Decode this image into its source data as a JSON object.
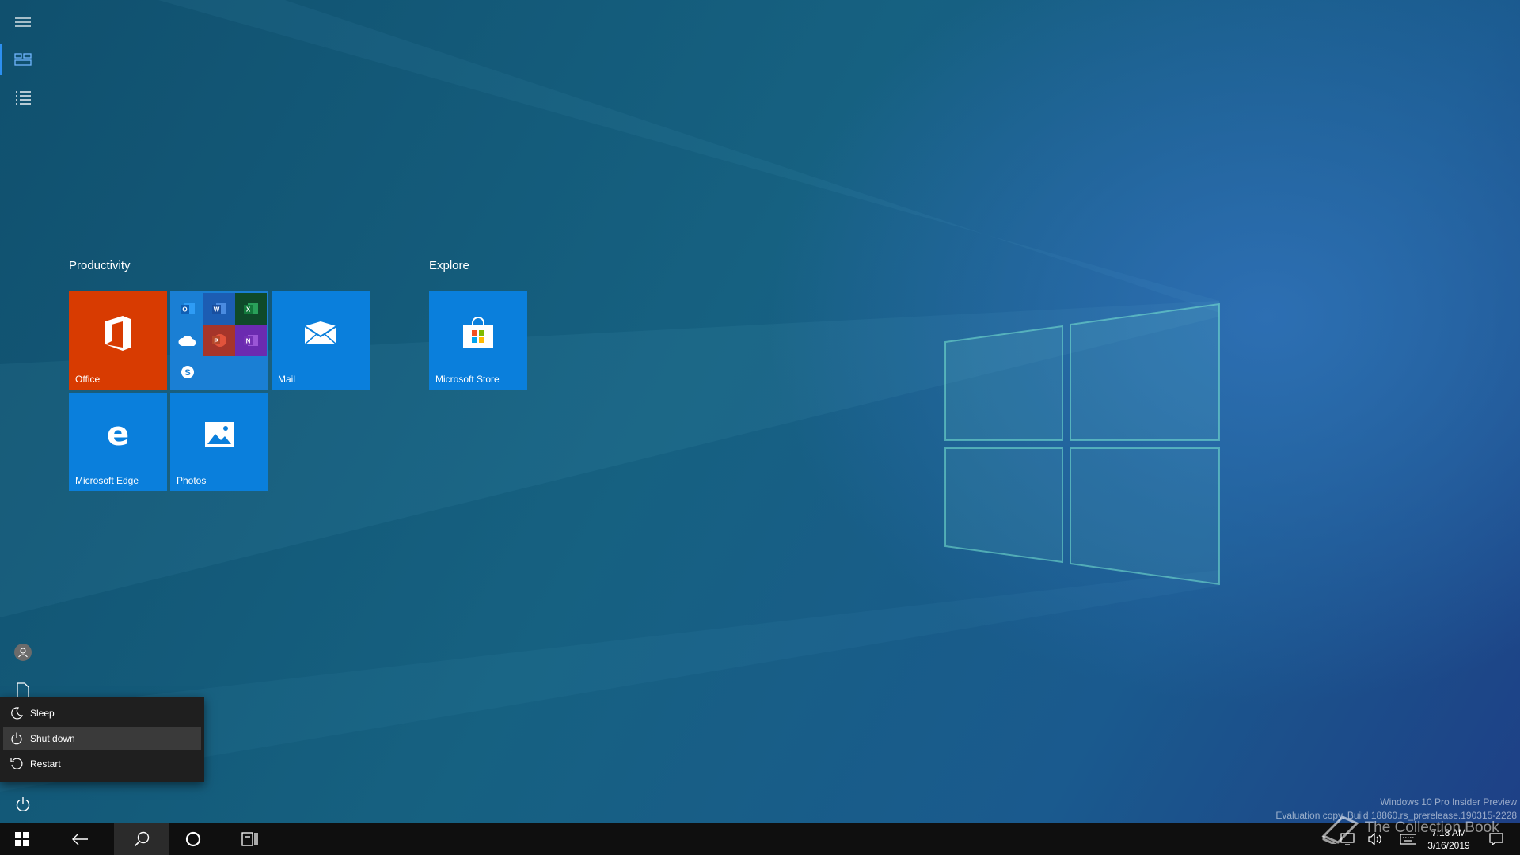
{
  "start": {
    "groups": [
      {
        "title": "Productivity",
        "tiles": [
          {
            "label": "Office",
            "color": "#d83b01",
            "icon": "office-icon"
          },
          {
            "label": "",
            "color": "#1a7fd4",
            "icon": "office-apps-folder",
            "apps": [
              "outlook-icon",
              "word-icon",
              "excel-icon",
              "onedrive-icon",
              "powerpoint-icon",
              "onenote-icon",
              "skype-icon"
            ]
          },
          {
            "label": "Mail",
            "color": "#0a7fdc",
            "icon": "mail-icon"
          },
          {
            "label": "Microsoft Edge",
            "color": "#0a7fdc",
            "icon": "edge-icon"
          },
          {
            "label": "Photos",
            "color": "#0a7fdc",
            "icon": "photos-icon"
          }
        ]
      },
      {
        "title": "Explore",
        "tiles": [
          {
            "label": "Microsoft Store",
            "color": "#0a7fdc",
            "icon": "store-icon"
          }
        ]
      }
    ]
  },
  "power_menu": {
    "items": [
      {
        "label": "Sleep",
        "icon": "moon-icon"
      },
      {
        "label": "Shut down",
        "icon": "power-icon",
        "highlighted": true
      },
      {
        "label": "Restart",
        "icon": "restart-icon"
      }
    ]
  },
  "taskbar": {
    "clock_time": "7:18 AM",
    "clock_date": "3/16/2019"
  },
  "watermark": {
    "line1": "Windows 10 Pro Insider Preview",
    "line2": "Evaluation copy. Build 18860.rs_prerelease.190315-2228",
    "overlay": "The Collection Book"
  },
  "colors": {
    "accent": "#0a7fdc",
    "office": "#d83b01",
    "menu_bg": "#1f1f1f",
    "taskbar": "#0f0f0f"
  }
}
